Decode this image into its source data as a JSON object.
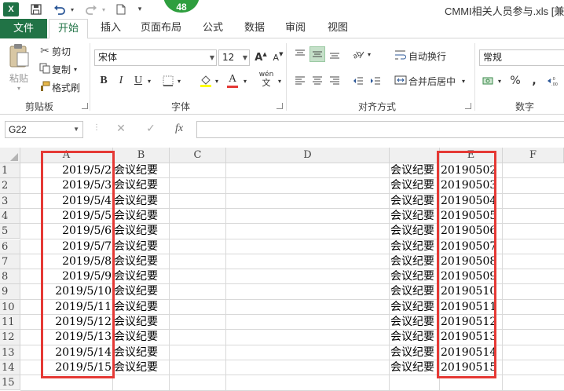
{
  "app": {
    "logo": "X",
    "badge": "48",
    "title": "CMMI相关人员参与.xls  [兼"
  },
  "qat": {
    "icons": [
      "excel-logo-icon",
      "save-icon",
      "undo-icon",
      "redo-icon",
      "new-file-icon",
      "customize-qat-icon"
    ]
  },
  "tabs": {
    "file": "文件",
    "items": [
      "开始",
      "插入",
      "页面布局",
      "公式",
      "数据",
      "审阅",
      "视图"
    ],
    "active": "开始"
  },
  "ribbon": {
    "clipboard": {
      "paste": "粘贴",
      "cut": "剪切",
      "copy": "复制",
      "format_painter": "格式刷",
      "label": "剪贴板"
    },
    "font": {
      "name": "宋体",
      "size": "12",
      "bold": "B",
      "italic": "I",
      "underline": "U",
      "grow": "A",
      "shrink": "A",
      "wen": "wén",
      "font_color_letter": "A",
      "label": "字体"
    },
    "alignment": {
      "wrap_text": "自动换行",
      "merge_center": "合并后居中",
      "label": "对齐方式"
    },
    "number": {
      "format": "常规",
      "percent": "%",
      "label": "数字"
    }
  },
  "formula_bar": {
    "name_box": "G22",
    "fx": "fx",
    "cancel": "✕",
    "enter": "✓",
    "formula": ""
  },
  "sheet": {
    "columns": [
      "A",
      "B",
      "C",
      "D",
      "E",
      "F"
    ],
    "rows": [
      {
        "n": "1",
        "a": "2019/5/2",
        "b": "会议纪要",
        "d": "会议纪要",
        "e": "20190502"
      },
      {
        "n": "2",
        "a": "2019/5/3",
        "b": "会议纪要",
        "d": "会议纪要",
        "e": "20190503"
      },
      {
        "n": "3",
        "a": "2019/5/4",
        "b": "会议纪要",
        "d": "会议纪要",
        "e": "20190504"
      },
      {
        "n": "4",
        "a": "2019/5/5",
        "b": "会议纪要",
        "d": "会议纪要",
        "e": "20190505"
      },
      {
        "n": "5",
        "a": "2019/5/6",
        "b": "会议纪要",
        "d": "会议纪要",
        "e": "20190506"
      },
      {
        "n": "6",
        "a": "2019/5/7",
        "b": "会议纪要",
        "d": "会议纪要",
        "e": "20190507"
      },
      {
        "n": "7",
        "a": "2019/5/8",
        "b": "会议纪要",
        "d": "会议纪要",
        "e": "20190508"
      },
      {
        "n": "8",
        "a": "2019/5/9",
        "b": "会议纪要",
        "d": "会议纪要",
        "e": "20190509"
      },
      {
        "n": "9",
        "a": "2019/5/10",
        "b": "会议纪要",
        "d": "会议纪要",
        "e": "20190510"
      },
      {
        "n": "10",
        "a": "2019/5/11",
        "b": "会议纪要",
        "d": "会议纪要",
        "e": "20190511"
      },
      {
        "n": "11",
        "a": "2019/5/12",
        "b": "会议纪要",
        "d": "会议纪要",
        "e": "20190512"
      },
      {
        "n": "12",
        "a": "2019/5/13",
        "b": "会议纪要",
        "d": "会议纪要",
        "e": "20190513"
      },
      {
        "n": "13",
        "a": "2019/5/14",
        "b": "会议纪要",
        "d": "会议纪要",
        "e": "20190514"
      },
      {
        "n": "14",
        "a": "2019/5/15",
        "b": "会议纪要",
        "d": "会议纪要",
        "e": "20190515"
      },
      {
        "n": "15",
        "a": "",
        "b": "",
        "d": "",
        "e": ""
      }
    ]
  },
  "colors": {
    "accent": "#217346",
    "highlight_box": "#e53935"
  }
}
